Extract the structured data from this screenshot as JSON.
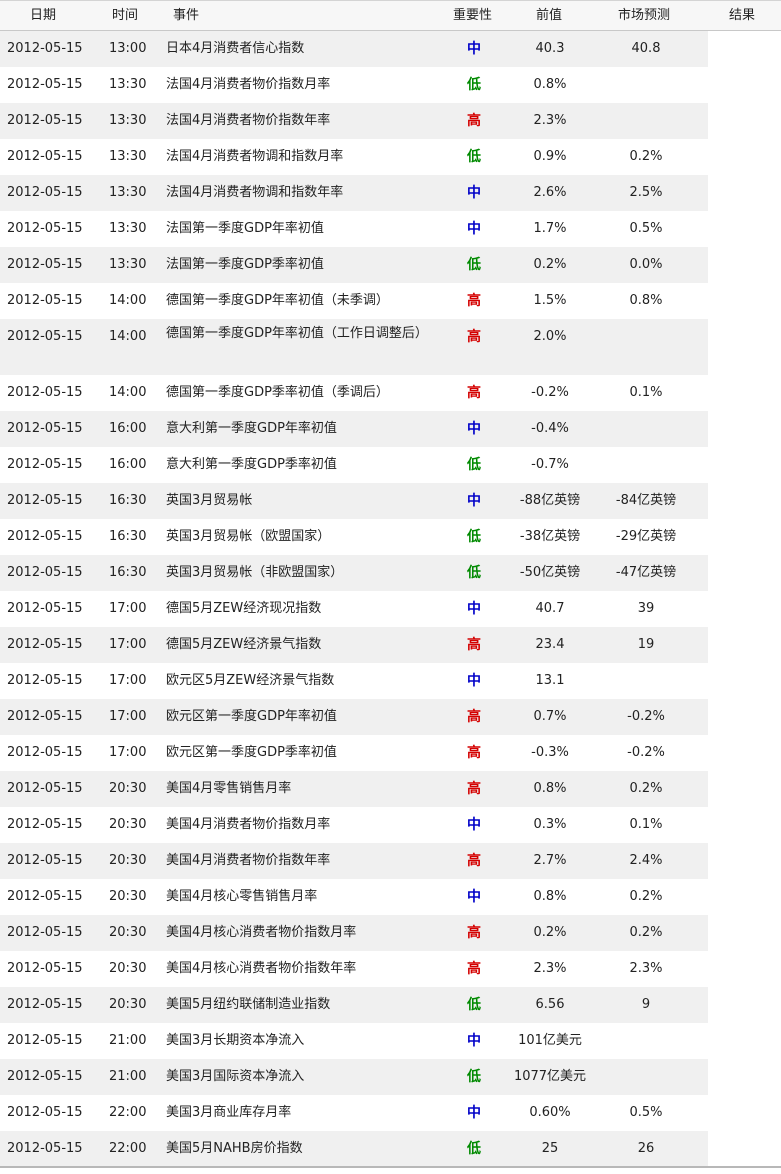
{
  "colors": {
    "high": "#d40000",
    "medium": "#0000c8",
    "low": "#008a00",
    "alt_row": "#f0f0f0",
    "header_bg": "#f7f7f7"
  },
  "header": {
    "date": "日期",
    "time": "时间",
    "event": "事件",
    "importance": "重要性",
    "previous": "前值",
    "forecast": "市场预测",
    "result": "结果"
  },
  "rows": [
    {
      "date": "2012-05-15",
      "time": "13:00",
      "event": "日本4月消费者信心指数",
      "importance": "中",
      "level": "medium",
      "previous": "40.3",
      "forecast": "40.8"
    },
    {
      "date": "2012-05-15",
      "time": "13:30",
      "event": "法国4月消费者物价指数月率",
      "importance": "低",
      "level": "low",
      "previous": "0.8%",
      "forecast": ""
    },
    {
      "date": "2012-05-15",
      "time": "13:30",
      "event": "法国4月消费者物价指数年率",
      "importance": "高",
      "level": "high",
      "previous": "2.3%",
      "forecast": ""
    },
    {
      "date": "2012-05-15",
      "time": "13:30",
      "event": "法国4月消费者物调和指数月率",
      "importance": "低",
      "level": "low",
      "previous": "0.9%",
      "forecast": "0.2%"
    },
    {
      "date": "2012-05-15",
      "time": "13:30",
      "event": "法国4月消费者物调和指数年率",
      "importance": "中",
      "level": "medium",
      "previous": "2.6%",
      "forecast": "2.5%"
    },
    {
      "date": "2012-05-15",
      "time": "13:30",
      "event": "法国第一季度GDP年率初值",
      "importance": "中",
      "level": "medium",
      "previous": "1.7%",
      "forecast": "0.5%"
    },
    {
      "date": "2012-05-15",
      "time": "13:30",
      "event": "法国第一季度GDP季率初值",
      "importance": "低",
      "level": "low",
      "previous": "0.2%",
      "forecast": "0.0%"
    },
    {
      "date": "2012-05-15",
      "time": "14:00",
      "event": "德国第一季度GDP年率初值（未季调）",
      "importance": "高",
      "level": "high",
      "previous": "1.5%",
      "forecast": "0.8%"
    },
    {
      "date": "2012-05-15",
      "time": "14:00",
      "event": "德国第一季度GDP年率初值（工作日调整后）",
      "importance": "高",
      "level": "high",
      "previous": "2.0%",
      "forecast": "",
      "tall": true
    },
    {
      "date": "2012-05-15",
      "time": "14:00",
      "event": "德国第一季度GDP季率初值（季调后）",
      "importance": "高",
      "level": "high",
      "previous": "-0.2%",
      "forecast": "0.1%"
    },
    {
      "date": "2012-05-15",
      "time": "16:00",
      "event": "意大利第一季度GDP年率初值",
      "importance": "中",
      "level": "medium",
      "previous": "-0.4%",
      "forecast": ""
    },
    {
      "date": "2012-05-15",
      "time": "16:00",
      "event": "意大利第一季度GDP季率初值",
      "importance": "低",
      "level": "low",
      "previous": "-0.7%",
      "forecast": ""
    },
    {
      "date": "2012-05-15",
      "time": "16:30",
      "event": "英国3月贸易帐",
      "importance": "中",
      "level": "medium",
      "previous": "-88亿英镑",
      "forecast": "-84亿英镑"
    },
    {
      "date": "2012-05-15",
      "time": "16:30",
      "event": "英国3月贸易帐（欧盟国家）",
      "importance": "低",
      "level": "low",
      "previous": "-38亿英镑",
      "forecast": "-29亿英镑"
    },
    {
      "date": "2012-05-15",
      "time": "16:30",
      "event": "英国3月贸易帐（非欧盟国家）",
      "importance": "低",
      "level": "low",
      "previous": "-50亿英镑",
      "forecast": "-47亿英镑"
    },
    {
      "date": "2012-05-15",
      "time": "17:00",
      "event": "德国5月ZEW经济现况指数",
      "importance": "中",
      "level": "medium",
      "previous": "40.7",
      "forecast": "39"
    },
    {
      "date": "2012-05-15",
      "time": "17:00",
      "event": "德国5月ZEW经济景气指数",
      "importance": "高",
      "level": "high",
      "previous": "23.4",
      "forecast": "19"
    },
    {
      "date": "2012-05-15",
      "time": "17:00",
      "event": "欧元区5月ZEW经济景气指数",
      "importance": "中",
      "level": "medium",
      "previous": "13.1",
      "forecast": ""
    },
    {
      "date": "2012-05-15",
      "time": "17:00",
      "event": "欧元区第一季度GDP年率初值",
      "importance": "高",
      "level": "high",
      "previous": "0.7%",
      "forecast": "-0.2%"
    },
    {
      "date": "2012-05-15",
      "time": "17:00",
      "event": "欧元区第一季度GDP季率初值",
      "importance": "高",
      "level": "high",
      "previous": "-0.3%",
      "forecast": "-0.2%"
    },
    {
      "date": "2012-05-15",
      "time": "20:30",
      "event": "美国4月零售销售月率",
      "importance": "高",
      "level": "high",
      "previous": "0.8%",
      "forecast": "0.2%"
    },
    {
      "date": "2012-05-15",
      "time": "20:30",
      "event": "美国4月消费者物价指数月率",
      "importance": "中",
      "level": "medium",
      "previous": "0.3%",
      "forecast": "0.1%"
    },
    {
      "date": "2012-05-15",
      "time": "20:30",
      "event": "美国4月消费者物价指数年率",
      "importance": "高",
      "level": "high",
      "previous": "2.7%",
      "forecast": "2.4%"
    },
    {
      "date": "2012-05-15",
      "time": "20:30",
      "event": "美国4月核心零售销售月率",
      "importance": "中",
      "level": "medium",
      "previous": "0.8%",
      "forecast": "0.2%"
    },
    {
      "date": "2012-05-15",
      "time": "20:30",
      "event": "美国4月核心消费者物价指数月率",
      "importance": "高",
      "level": "high",
      "previous": "0.2%",
      "forecast": "0.2%"
    },
    {
      "date": "2012-05-15",
      "time": "20:30",
      "event": "美国4月核心消费者物价指数年率",
      "importance": "高",
      "level": "high",
      "previous": "2.3%",
      "forecast": "2.3%"
    },
    {
      "date": "2012-05-15",
      "time": "20:30",
      "event": "美国5月纽约联储制造业指数",
      "importance": "低",
      "level": "low",
      "previous": "6.56",
      "forecast": "9"
    },
    {
      "date": "2012-05-15",
      "time": "21:00",
      "event": "美国3月长期资本净流入",
      "importance": "中",
      "level": "medium",
      "previous": "101亿美元",
      "forecast": ""
    },
    {
      "date": "2012-05-15",
      "time": "21:00",
      "event": "美国3月国际资本净流入",
      "importance": "低",
      "level": "low",
      "previous": "1077亿美元",
      "forecast": ""
    },
    {
      "date": "2012-05-15",
      "time": "22:00",
      "event": "美国3月商业库存月率",
      "importance": "中",
      "level": "medium",
      "previous": "0.60%",
      "forecast": "0.5%"
    },
    {
      "date": "2012-05-15",
      "time": "22:00",
      "event": "美国5月NAHB房价指数",
      "importance": "低",
      "level": "low",
      "previous": "25",
      "forecast": "26"
    }
  ]
}
